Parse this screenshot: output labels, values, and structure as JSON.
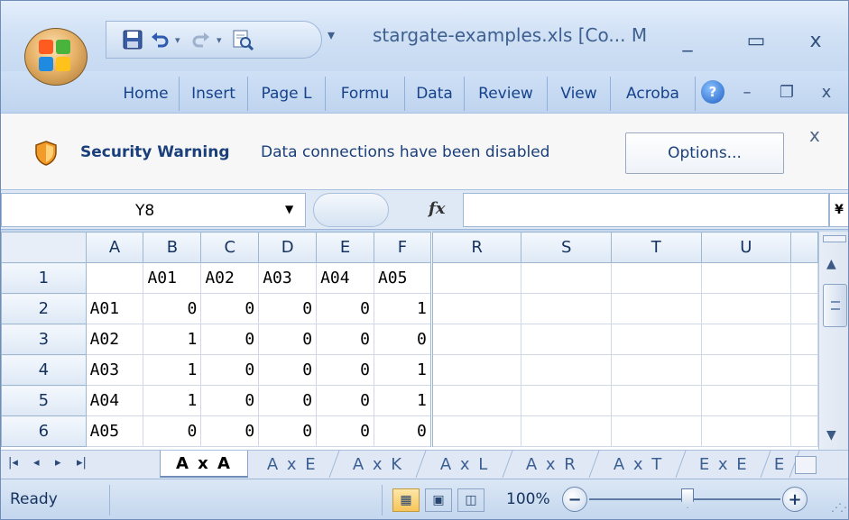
{
  "window": {
    "title": "stargate-examples.xls  [Co... M",
    "controls": {
      "minimize": "_",
      "maximize": "▭",
      "close": "x"
    }
  },
  "qat": {
    "save_icon": "save-icon",
    "undo_icon": "undo-icon",
    "redo_icon": "redo-icon",
    "menu_arrow": "▾"
  },
  "ribbon": {
    "tabs": [
      "Home",
      "Insert",
      "Page L",
      "Formu",
      "Data",
      "Review",
      "View",
      "Acroba"
    ],
    "help_label": "?",
    "doc_minimize": "–",
    "doc_restore": "❐",
    "doc_close": "x"
  },
  "security": {
    "title": "Security Warning",
    "message": "Data connections have been disabled",
    "options_label": "Options...",
    "close": "x"
  },
  "formula_bar": {
    "name_box": "Y8",
    "fx_label": "fx",
    "formula_value": "",
    "expand": "¥"
  },
  "grid": {
    "columns": [
      "A",
      "B",
      "C",
      "D",
      "E",
      "F",
      "R",
      "S",
      "T",
      "U",
      ""
    ],
    "rows": [
      {
        "num": "1",
        "cells": [
          "",
          "A01",
          "A02",
          "A03",
          "A04",
          "A05",
          "",
          "",
          "",
          "",
          ""
        ]
      },
      {
        "num": "2",
        "cells": [
          "A01",
          "0",
          "0",
          "0",
          "0",
          "1",
          "",
          "",
          "",
          "",
          ""
        ]
      },
      {
        "num": "3",
        "cells": [
          "A02",
          "1",
          "0",
          "0",
          "0",
          "0",
          "",
          "",
          "",
          "",
          ""
        ]
      },
      {
        "num": "4",
        "cells": [
          "A03",
          "1",
          "0",
          "0",
          "0",
          "1",
          "",
          "",
          "",
          "",
          ""
        ]
      },
      {
        "num": "5",
        "cells": [
          "A04",
          "1",
          "0",
          "0",
          "0",
          "1",
          "",
          "",
          "",
          "",
          ""
        ]
      },
      {
        "num": "6",
        "cells": [
          "A05",
          "0",
          "0",
          "0",
          "0",
          "0",
          "",
          "",
          "",
          "",
          ""
        ]
      }
    ]
  },
  "sheet_tabs": {
    "nav": [
      "|◂",
      "◂",
      "▸",
      "▸|"
    ],
    "tabs": [
      "A x A",
      "A x E",
      "A x K",
      "A x L",
      "A x R",
      "A x T",
      "E x E",
      "E"
    ],
    "active": "A x A"
  },
  "status": {
    "ready": "Ready",
    "zoom": "100%",
    "zoom_out": "−",
    "zoom_in": "+"
  }
}
